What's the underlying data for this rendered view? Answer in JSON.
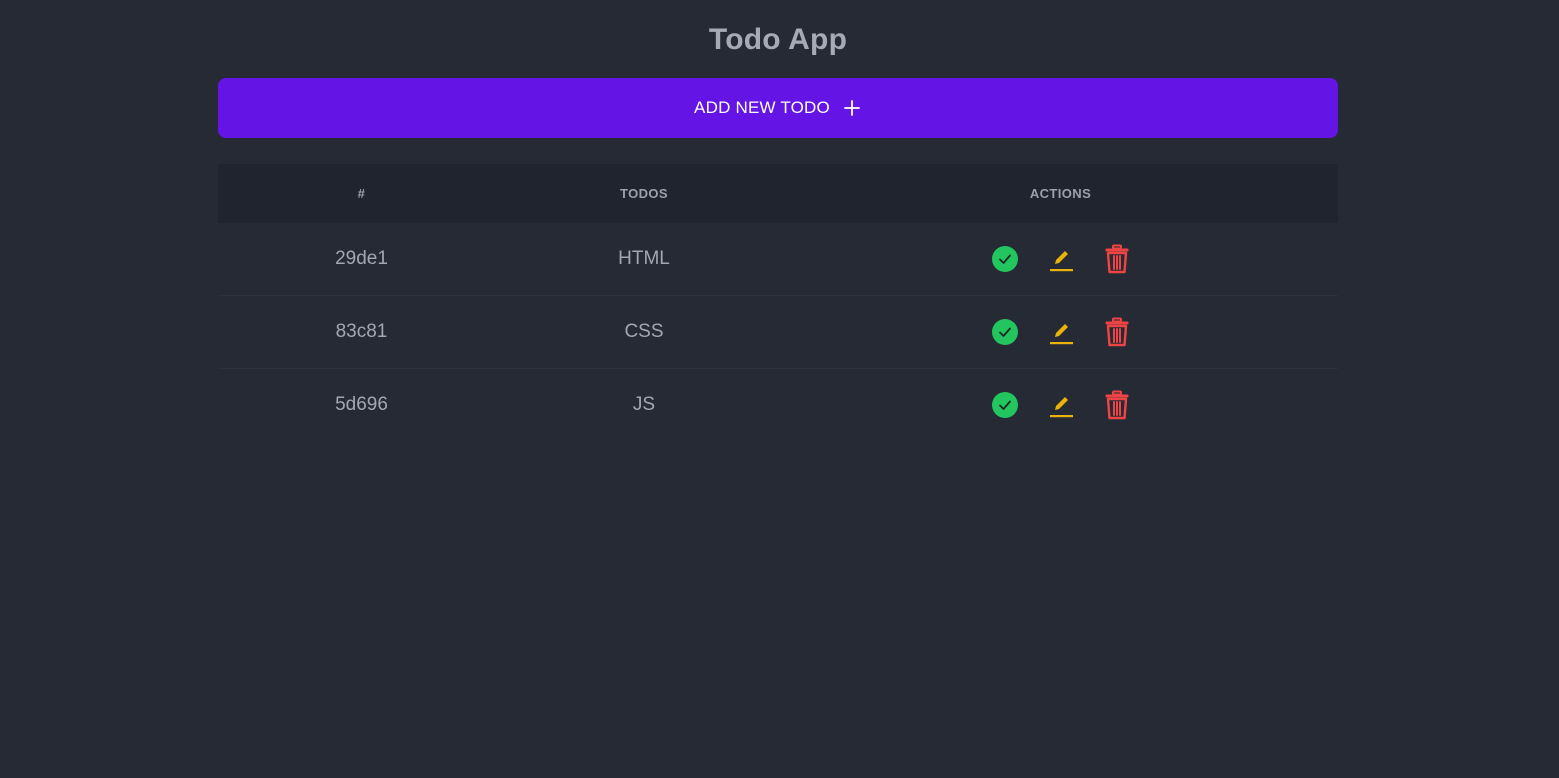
{
  "app": {
    "title": "Todo App"
  },
  "add_button": {
    "label": "ADD NEW TODO",
    "icon": "plus-icon"
  },
  "table": {
    "headers": {
      "id": "#",
      "todos": "TODOS",
      "actions": "ACTIONS"
    },
    "rows": [
      {
        "id": "29de1",
        "todo": "HTML"
      },
      {
        "id": "83c81",
        "todo": "CSS"
      },
      {
        "id": "5d696",
        "todo": "JS"
      }
    ],
    "action_icons": [
      "check-circle-icon",
      "pencil-icon",
      "trash-icon"
    ]
  },
  "colors": {
    "background": "#252a35",
    "accent": "#6415e6",
    "complete": "#22c55e",
    "edit": "#eab308",
    "delete": "#ef4444"
  }
}
